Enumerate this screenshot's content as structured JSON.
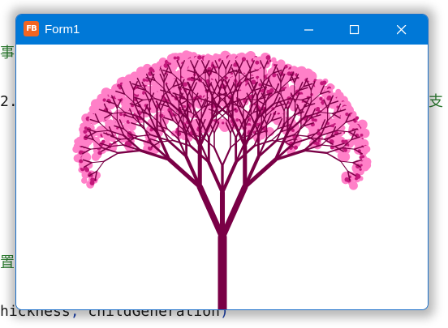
{
  "background_code": {
    "line1": "事",
    "line2_left": "2.",
    "line2_right": "支",
    "line3": "置",
    "line4_a": "hickness",
    "line4_b": ", ",
    "line4_c": "childGeneration",
    "line4_d": ")"
  },
  "window": {
    "title": "Form1",
    "app_icon_text": "FB",
    "icon_names": {
      "app": "app-icon",
      "minimize": "minimize-icon",
      "maximize": "maximize-icon",
      "close": "close-icon"
    }
  },
  "colors": {
    "titlebar": "#0078d7",
    "trunk": "#7a0046",
    "blossom": "#ff80c8",
    "blossom_dark": "#c2187a"
  }
}
